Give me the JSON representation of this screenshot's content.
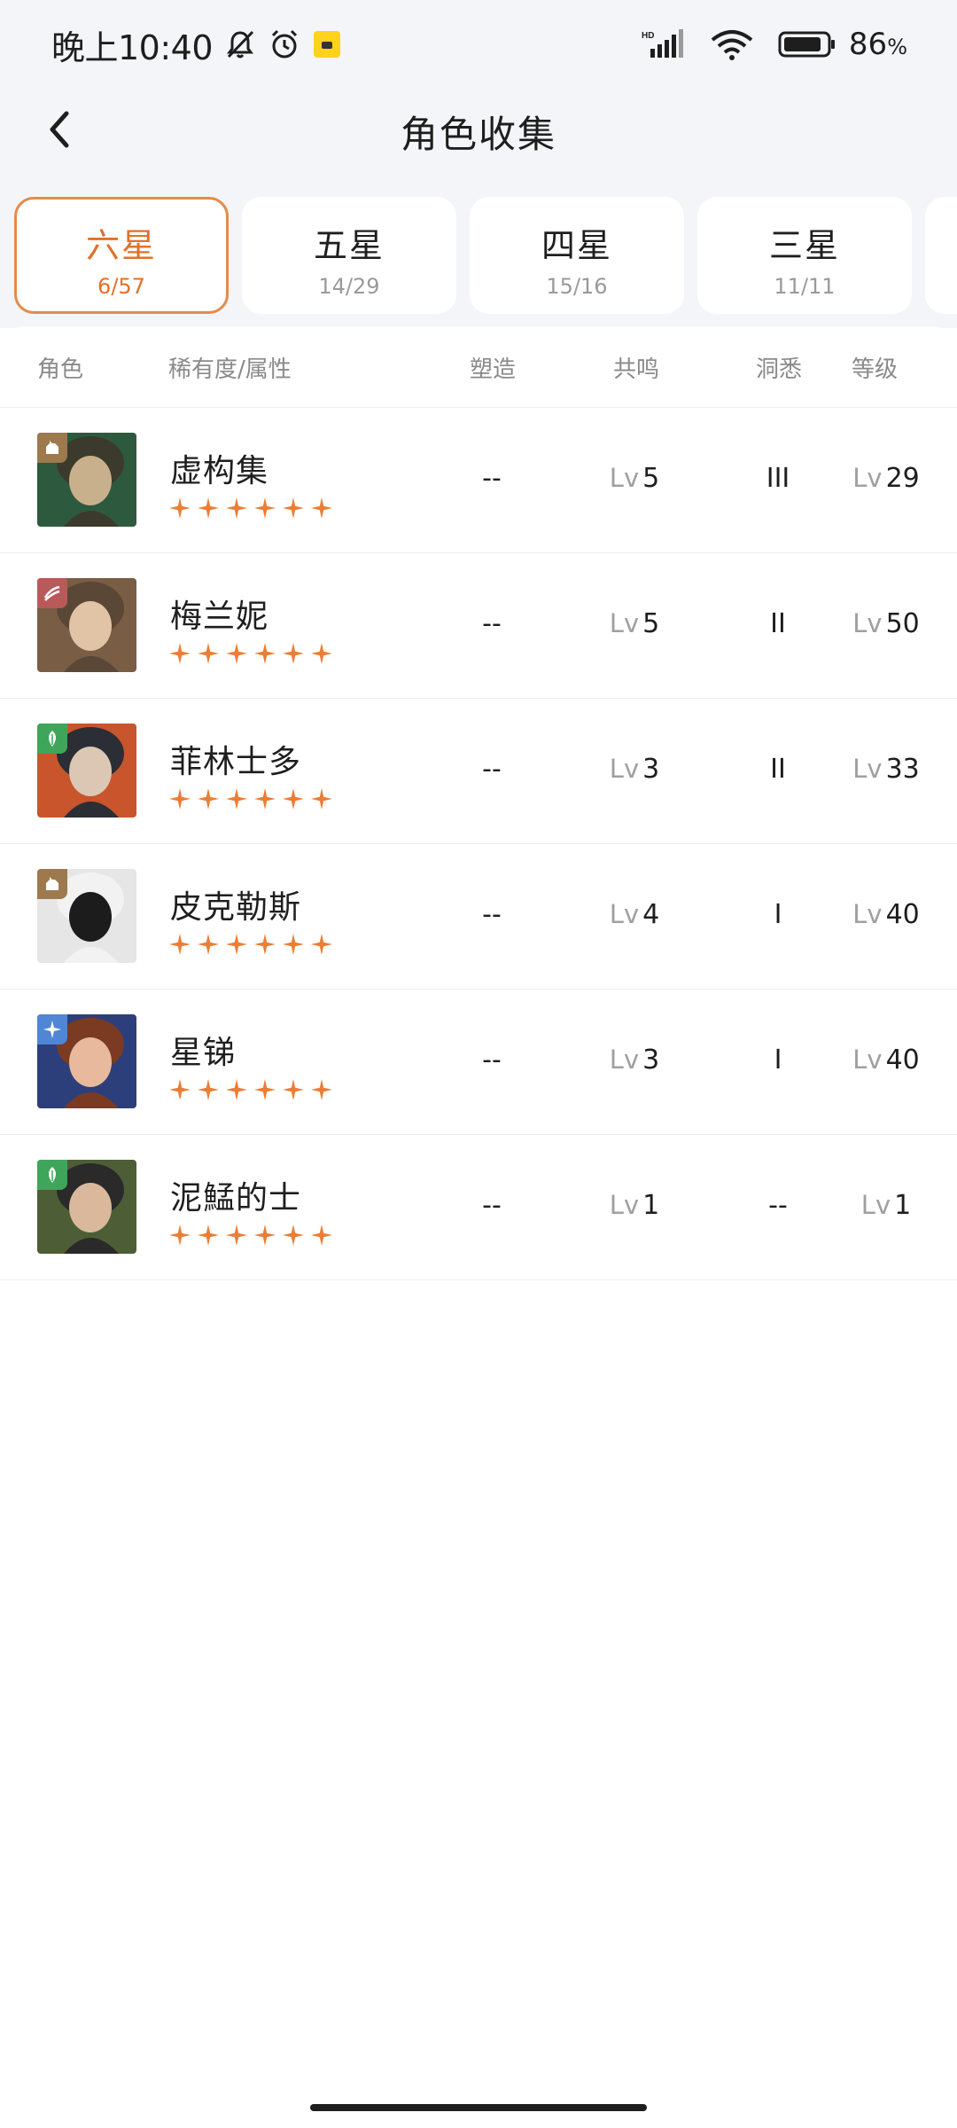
{
  "status_bar": {
    "time": "晚上10:40",
    "battery_percent": "86",
    "battery_unit": "%",
    "network_label": "HD"
  },
  "header": {
    "title": "角色收集"
  },
  "tabs": [
    {
      "label": "六星",
      "count": "6/57",
      "active": true
    },
    {
      "label": "五星",
      "count": "14/29",
      "active": false
    },
    {
      "label": "四星",
      "count": "15/16",
      "active": false
    },
    {
      "label": "三星",
      "count": "11/11",
      "active": false
    }
  ],
  "columns": {
    "role": "角色",
    "rarity": "稀有度/属性",
    "shape": "塑造",
    "resonance": "共鸣",
    "insight": "洞悉",
    "level": "等级"
  },
  "lv_prefix": "Lv",
  "characters": [
    {
      "name": "虚构集",
      "stars": 6,
      "shape": "--",
      "resonance": "5",
      "insight": "III",
      "level": "29",
      "attribute": "beast-icon",
      "attr_color": "#9c7a4e"
    },
    {
      "name": "梅兰妮",
      "stars": 6,
      "shape": "--",
      "resonance": "5",
      "insight": "II",
      "level": "50",
      "attribute": "wave-icon",
      "attr_color": "#b85a5a"
    },
    {
      "name": "菲林士多",
      "stars": 6,
      "shape": "--",
      "resonance": "3",
      "insight": "II",
      "level": "33",
      "attribute": "leaf-icon",
      "attr_color": "#3fa55a"
    },
    {
      "name": "皮克勒斯",
      "stars": 6,
      "shape": "--",
      "resonance": "4",
      "insight": "I",
      "level": "40",
      "attribute": "beast-icon",
      "attr_color": "#9c7a4e"
    },
    {
      "name": "星锑",
      "stars": 6,
      "shape": "--",
      "resonance": "3",
      "insight": "I",
      "level": "40",
      "attribute": "star-icon",
      "attr_color": "#4f86d6"
    },
    {
      "name": "泥鯭的士",
      "stars": 6,
      "shape": "--",
      "resonance": "1",
      "insight": "--",
      "level": "1",
      "attribute": "leaf-icon",
      "attr_color": "#3fa55a"
    }
  ],
  "colors": {
    "accent": "#e0722a",
    "star": "#ec7d35",
    "background": "#f4f5f8"
  }
}
